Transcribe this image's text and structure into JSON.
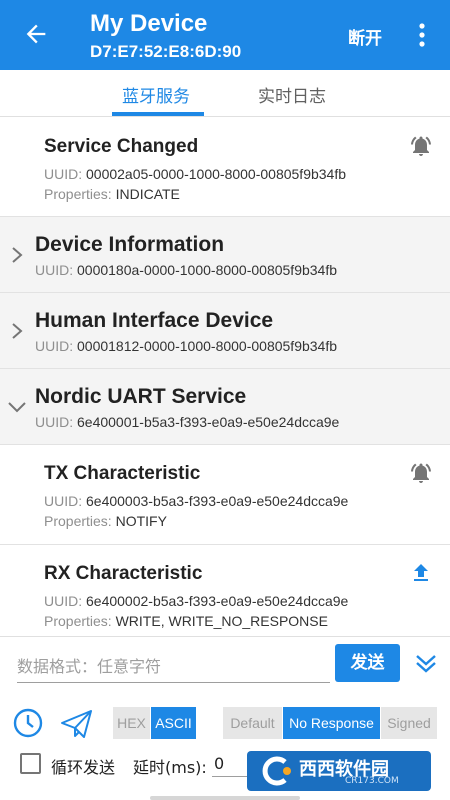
{
  "appbar": {
    "title": "My Device",
    "address": "D7:E7:52:E8:6D:90",
    "disconnect_label": "断开",
    "icons": {
      "back": "arrow-back-icon",
      "more": "more-vert-icon"
    }
  },
  "tabs": [
    {
      "label": "蓝牙服务",
      "selected": true
    },
    {
      "label": "实时日志",
      "selected": false
    }
  ],
  "labels": {
    "uuid": "UUID: ",
    "properties": "Properties: "
  },
  "services": [
    {
      "name": "Service Changed",
      "uuid": "00002a05-0000-1000-8000-00805f9b34fb",
      "properties": "INDICATE",
      "icon": "bell-ring-icon"
    },
    {
      "name": "Device Information",
      "uuid": "0000180a-0000-1000-8000-00805f9b34fb",
      "expanded": false
    },
    {
      "name": "Human Interface Device",
      "uuid": "00001812-0000-1000-8000-00805f9b34fb",
      "expanded": false
    },
    {
      "name": "Nordic UART Service",
      "uuid": "6e400001-b5a3-f393-e0a9-e50e24dcca9e",
      "expanded": true
    },
    {
      "name": "TX Characteristic",
      "uuid": "6e400003-b5a3-f393-e0a9-e50e24dcca9e",
      "properties": "NOTIFY",
      "icon": "bell-ring-icon"
    },
    {
      "name": "RX Characteristic",
      "uuid": "6e400002-b5a3-f393-e0a9-e50e24dcca9e",
      "properties": "WRITE, WRITE_NO_RESPONSE",
      "icon": "upload-icon"
    }
  ],
  "send_panel": {
    "input_placeholder": "数据格式：任意字符",
    "input_value": "",
    "send_label": "发送",
    "format_options": [
      {
        "label": "HEX",
        "selected": false
      },
      {
        "label": "ASCII",
        "selected": true
      }
    ],
    "write_type_options": [
      {
        "label": "Default",
        "selected": false
      },
      {
        "label": "No Response",
        "selected": true
      },
      {
        "label": "Signed",
        "selected": false
      }
    ],
    "loop_send_label": "循环发送",
    "loop_send_checked": false,
    "delay_label": "延时(ms):",
    "delay_value": "0"
  },
  "watermark": {
    "text": "西西软件园",
    "sub": "CR173.COM"
  },
  "colors": {
    "primary": "#1e88e5",
    "service_bg": "#f4f4f4",
    "muted": "#8e8e8e",
    "segment_off": "#e6e6e6"
  }
}
